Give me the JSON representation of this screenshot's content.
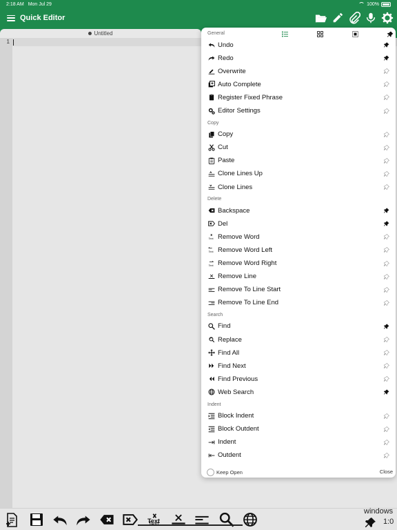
{
  "status": {
    "time": "2:18 AM",
    "date": "Mon Jul 29",
    "battery": "100%"
  },
  "nav": {
    "title": "Quick Editor",
    "actions": [
      "folder-open-icon",
      "pencil-icon",
      "paperclip-icon",
      "microphone-icon",
      "gear-icon"
    ]
  },
  "tab": {
    "title": "Untitled"
  },
  "editor": {
    "line_numbers": [
      "1"
    ]
  },
  "menu": {
    "view_tabs": [
      "list-icon",
      "grid-icon",
      "select-icon",
      "pin-icon"
    ],
    "sections": [
      {
        "title": "General",
        "items": [
          {
            "label": "Undo",
            "icon": "undo-icon",
            "pinned": true
          },
          {
            "label": "Redo",
            "icon": "redo-icon",
            "pinned": true
          },
          {
            "label": "Overwrite",
            "icon": "pen-line-icon",
            "pinned": false
          },
          {
            "label": "Auto Complete",
            "icon": "auto-complete-icon",
            "pinned": false
          },
          {
            "label": "Register Fixed Phrase",
            "icon": "clipboard-icon",
            "pinned": false
          },
          {
            "label": "Editor Settings",
            "icon": "gears-icon",
            "pinned": false
          }
        ]
      },
      {
        "title": "Copy",
        "items": [
          {
            "label": "Copy",
            "icon": "copy-icon",
            "pinned": false
          },
          {
            "label": "Cut",
            "icon": "scissors-icon",
            "pinned": false
          },
          {
            "label": "Paste",
            "icon": "paste-icon",
            "pinned": false
          },
          {
            "label": "Clone Lines Up",
            "icon": "clone-up-icon",
            "pinned": false
          },
          {
            "label": "Clone Lines",
            "icon": "clone-down-icon",
            "pinned": false
          }
        ]
      },
      {
        "title": "Delete",
        "items": [
          {
            "label": "Backspace",
            "icon": "backspace-icon",
            "pinned": true
          },
          {
            "label": "Del",
            "icon": "delete-icon",
            "pinned": true
          },
          {
            "label": "Remove Word",
            "icon": "remove-word-icon",
            "pinned": false
          },
          {
            "label": "Remove Word Left",
            "icon": "remove-word-left-icon",
            "pinned": false
          },
          {
            "label": "Remove Word Right",
            "icon": "remove-word-right-icon",
            "pinned": false
          },
          {
            "label": "Remove Line",
            "icon": "remove-line-icon",
            "pinned": false
          },
          {
            "label": "Remove To Line Start",
            "icon": "remove-line-start-icon",
            "pinned": false
          },
          {
            "label": "Remove To Line End",
            "icon": "remove-line-end-icon",
            "pinned": false
          }
        ]
      },
      {
        "title": "Search",
        "items": [
          {
            "label": "Find",
            "icon": "magnifier-icon",
            "pinned": true
          },
          {
            "label": "Replace",
            "icon": "replace-icon",
            "pinned": false
          },
          {
            "label": "Find All",
            "icon": "find-all-icon",
            "pinned": false
          },
          {
            "label": "Find Next",
            "icon": "find-next-icon",
            "pinned": false
          },
          {
            "label": "Find Previous",
            "icon": "find-previous-icon",
            "pinned": false
          },
          {
            "label": "Web Search",
            "icon": "globe-icon",
            "pinned": true
          }
        ]
      },
      {
        "title": "Indent",
        "items": [
          {
            "label": "Block Indent",
            "icon": "block-indent-icon",
            "pinned": false
          },
          {
            "label": "Block Outdent",
            "icon": "block-outdent-icon",
            "pinned": false
          },
          {
            "label": "Indent",
            "icon": "indent-icon",
            "pinned": false
          },
          {
            "label": "Outdent",
            "icon": "outdent-icon",
            "pinned": false
          }
        ]
      }
    ],
    "footer": {
      "keep_open": "Keep Open",
      "close": "Close"
    }
  },
  "toolbar": {
    "buttons": [
      "new-file-icon",
      "save-icon",
      "undo-icon",
      "redo-icon",
      "backspace-icon",
      "delete-icon",
      "remove-word-icon",
      "remove-line-icon",
      "remove-line-start-icon",
      "magnifier-icon",
      "globe-icon"
    ],
    "text_label": "Text",
    "os": "windows",
    "cursor_pos": "1:0"
  },
  "colors": {
    "accent": "#1e8a4d",
    "menu_bg": "#ffffff",
    "editor_bg": "#e6e6e6"
  }
}
